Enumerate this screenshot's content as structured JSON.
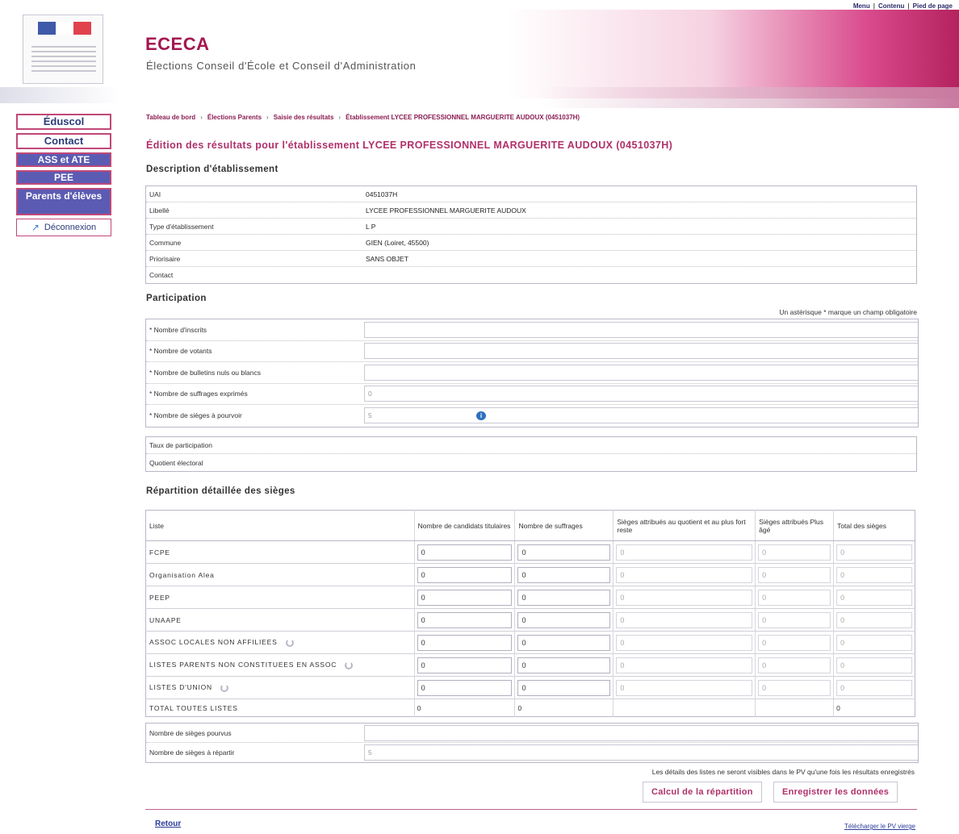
{
  "top_links": [
    "Menu",
    "Contenu",
    "Pied de page"
  ],
  "header": {
    "title": "ECECA",
    "subtitle": "Élections Conseil d'École et Conseil d'Administration"
  },
  "sidebar": {
    "items": [
      {
        "label": "Éduscol"
      },
      {
        "label": "Contact"
      },
      {
        "label": "ASS et ATE"
      },
      {
        "label": "PEE"
      },
      {
        "label": "Parents d'élèves"
      },
      {
        "label": "Déconnexion"
      }
    ]
  },
  "breadcrumb": [
    "Tableau de bord",
    "Élections Parents",
    "Saisie des résultats",
    "Établissement LYCEE PROFESSIONNEL MARGUERITE AUDOUX (0451037H)"
  ],
  "page_title": "Édition des résultats pour l'établissement LYCEE PROFESSIONNEL MARGUERITE AUDOUX (0451037H)",
  "description": {
    "title": "Description d'établissement",
    "rows": [
      {
        "label": "UAI",
        "value": "0451037H"
      },
      {
        "label": "Libellé",
        "value": "LYCEE PROFESSIONNEL MARGUERITE AUDOUX"
      },
      {
        "label": "Type d'établissement",
        "value": "L P"
      },
      {
        "label": "Commune",
        "value": "GIEN (Loiret, 45500)"
      },
      {
        "label": "Priorisaire",
        "value": "SANS OBJET"
      },
      {
        "label": "Contact",
        "value": ""
      }
    ]
  },
  "participation": {
    "title": "Participation",
    "required_note": "Un astérisque * marque un champ obligatoire",
    "fields": [
      {
        "label": "* Nombre d'inscrits",
        "value": ""
      },
      {
        "label": "* Nombre de votants",
        "value": ""
      },
      {
        "label": "* Nombre de bulletins nuls ou blancs",
        "value": ""
      },
      {
        "label": "* Nombre de suffrages exprimés",
        "value": "0"
      },
      {
        "label": "* Nombre de sièges à pourvoir",
        "value": "5"
      }
    ],
    "info_icon": "i",
    "rates": [
      {
        "label": "Taux de participation",
        "value": ""
      },
      {
        "label": "Quotient électoral",
        "value": ""
      }
    ]
  },
  "repartition": {
    "title": "Répartition détaillée des sièges",
    "headers": {
      "liste": "Liste",
      "candidats": "Nombre de candidats titulaires",
      "suffrages": "Nombre de suffrages",
      "sieges_quotient": "Sièges attribués au quotient et au plus fort reste",
      "sieges_age": "Sièges attribués Plus âgé",
      "total": "Total des sièges"
    },
    "rows": [
      {
        "name": "FCPE",
        "refresh": false,
        "candidats": "0",
        "suffrages": "0",
        "quotient": "0",
        "age": "0",
        "total": "0"
      },
      {
        "name": "Organisation Alea",
        "refresh": false,
        "candidats": "0",
        "suffrages": "0",
        "quotient": "0",
        "age": "0",
        "total": "0"
      },
      {
        "name": "PEEP",
        "refresh": false,
        "candidats": "0",
        "suffrages": "0",
        "quotient": "0",
        "age": "0",
        "total": "0"
      },
      {
        "name": "UNAAPE",
        "refresh": false,
        "candidats": "0",
        "suffrages": "0",
        "quotient": "0",
        "age": "0",
        "total": "0"
      },
      {
        "name": "ASSOC LOCALES NON AFFILIEES",
        "refresh": true,
        "candidats": "0",
        "suffrages": "0",
        "quotient": "0",
        "age": "0",
        "total": "0"
      },
      {
        "name": "LISTES PARENTS NON CONSTITUEES EN ASSOC",
        "refresh": true,
        "candidats": "0",
        "suffrages": "0",
        "quotient": "0",
        "age": "0",
        "total": "0"
      },
      {
        "name": "LISTES D'UNION",
        "refresh": true,
        "candidats": "0",
        "suffrages": "0",
        "quotient": "0",
        "age": "0",
        "total": "0"
      }
    ],
    "total_row": {
      "name": "TOTAL TOUTES LISTES",
      "candidats": "0",
      "suffrages": "0",
      "total": "0"
    },
    "summary": [
      {
        "label": "Nombre de sièges pourvus",
        "value": ""
      },
      {
        "label": "Nombre de sièges à répartir",
        "value": "5"
      }
    ],
    "note": "Les détails des listes ne seront visibles dans le PV qu'une fois les résultats enregistrés"
  },
  "buttons": {
    "calcul": "Calcul de la répartition",
    "enregistrer": "Enregistrer les données"
  },
  "footer": {
    "retour": "Retour",
    "pv": "Télécharger le PV vierge"
  },
  "colors": {
    "brand": "#a3174f",
    "nav_dark": "#5b5bb3",
    "link": "#2b3b9a"
  }
}
